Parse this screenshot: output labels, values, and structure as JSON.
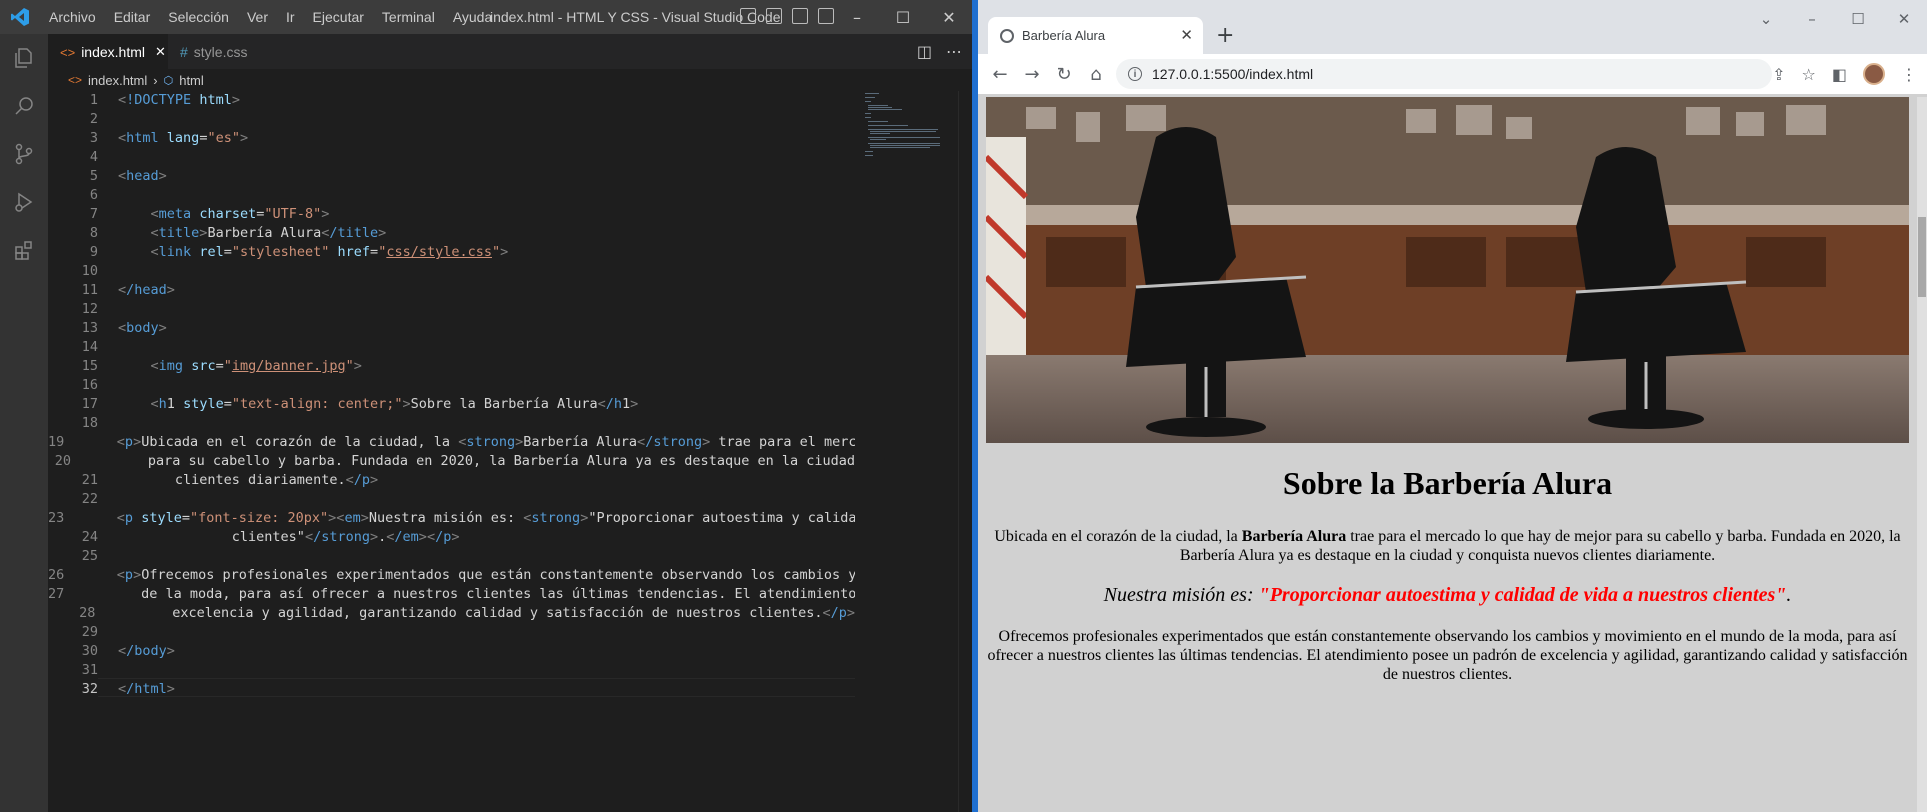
{
  "vscode": {
    "menu": [
      "Archivo",
      "Editar",
      "Selección",
      "Ver",
      "Ir",
      "Ejecutar",
      "Terminal",
      "Ayuda"
    ],
    "window_title": "index.html - HTML Y CSS - Visual Studio Code",
    "tabs": [
      {
        "label": "index.html",
        "icon": "html-file-icon",
        "active": true
      },
      {
        "label": "style.css",
        "icon": "css-file-icon",
        "active": false
      }
    ],
    "breadcrumb": [
      "index.html",
      "html"
    ],
    "current_line": 32,
    "code_lines": [
      "<!DOCTYPE html>",
      "",
      "<html lang=\"es\">",
      "",
      "<head>",
      "",
      "<meta charset=\"UTF-8\">",
      "<title>Barbería Alura</title>",
      "<link rel=\"stylesheet\" href=\"css/style.css\">",
      "",
      "</head>",
      "",
      "<body>",
      "",
      "<img src=\"img/banner.jpg\">",
      "",
      "<h1 style=\"text-align: center;\">Sobre la Barbería Alura</h1>",
      "",
      "<p>Ubicada en el corazón de la ciudad, la <strong>Barbería Alura</strong> trae para el merca",
      "para su cabello y barba. Fundada en 2020, la Barbería Alura ya es destaque en la ciudad",
      "clientes diariamente.</p>",
      "",
      "<p style=\"font-size: 20px\"><em>Nuestra misión es: <strong>\"Proporcionar autoestima y calidad",
      "clientes\"</strong>.</em></p>",
      "",
      "<p>Ofrecemos profesionales experimentados que están constantemente observando los cambios y",
      "de la moda, para así ofrecer a nuestros clientes las últimas tendencias. El atendimiento",
      "excelencia y agilidad, garantizando calidad y satisfacción de nuestros clientes.</p>",
      "",
      "</body>",
      "",
      "</html>"
    ]
  },
  "browser": {
    "tab_title": "Barbería Alura",
    "url": "127.0.0.1:5500/index.html",
    "page": {
      "h1": "Sobre la Barbería Alura",
      "p1_pre": "Ubicada en el corazón de la ciudad, la ",
      "p1_strong": "Barbería Alura",
      "p1_post": " trae para el mercado lo que hay de mejor para su cabello y barba. Fundada en 2020, la Barbería Alura ya es destaque en la ciudad y conquista nuevos clientes diariamente.",
      "p2_pre": "Nuestra misión es: ",
      "p2_strong": "\"Proporcionar autoestima y calidad de vida a nuestros clientes\"",
      "p2_post": ".",
      "p3": "Ofrecemos profesionales experimentados que están constantemente observando los cambios y movimiento en el mundo de la moda, para así ofrecer a nuestros clientes las últimas tendencias. El atendimiento posee un padrón de excelencia y agilidad, garantizando calidad y satisfacción de nuestros clientes."
    }
  },
  "colors": {
    "vscode_bg": "#1e1e1e",
    "titlebar": "#3c3c3c",
    "page_bg": "#d1d1d1",
    "mission_strong": "#ff0000",
    "accent": "#1f6fd0"
  }
}
